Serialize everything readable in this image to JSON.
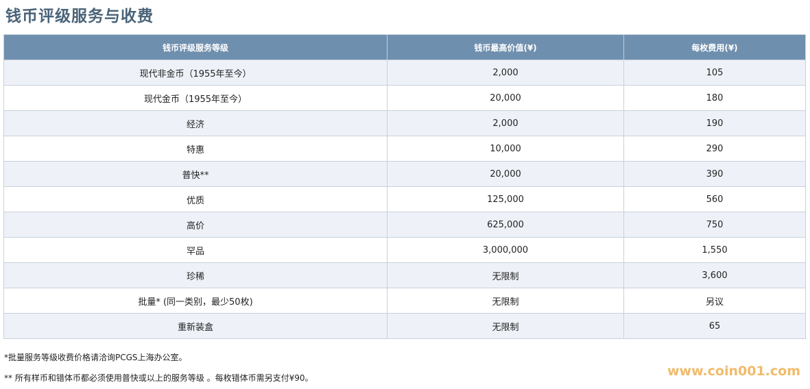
{
  "title": "钱币评级服务与收费",
  "table": {
    "headers": [
      "钱币评级服务等级",
      "钱币最高价值(¥)",
      "每枚费用(¥)"
    ],
    "rows": [
      [
        "现代非金币（1955年至今）",
        "2,000",
        "105"
      ],
      [
        "现代金币（1955年至今）",
        "20,000",
        "180"
      ],
      [
        "经济",
        "2,000",
        "190"
      ],
      [
        "特惠",
        "10,000",
        "290"
      ],
      [
        "普快**",
        "20,000",
        "390"
      ],
      [
        "优质",
        "125,000",
        "560"
      ],
      [
        "高价",
        "625,000",
        "750"
      ],
      [
        "罕品",
        "3,000,000",
        "1,550"
      ],
      [
        "珍稀",
        "无限制",
        "3,600"
      ],
      [
        "批量* (同一类别，最少50枚)",
        "无限制",
        "另议"
      ],
      [
        "重新装盒",
        "无限制",
        "65"
      ]
    ]
  },
  "notes": [
    "*批量服务等级收费价格请洽询PCGS上海办公室。",
    "** 所有样币和错体币都必须使用普快或以上的服务等级 。每枚错体币需另支付¥90。"
  ],
  "watermark": "www.coin001.com",
  "colors": {
    "header_bg": "#6f8fae",
    "title": "#4a6378",
    "row_stripe": "#eef2f8",
    "watermark": "#f0bb6a"
  }
}
